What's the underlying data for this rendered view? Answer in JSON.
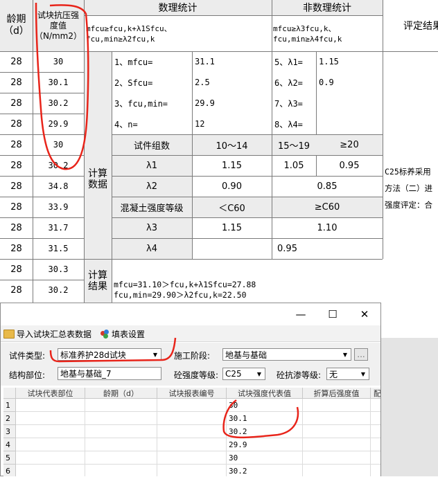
{
  "sheet": {
    "headers": {
      "age": "龄期\n（d）",
      "strength": "试块抗压强\n度值\n（N/mm2）",
      "stat": "数理统计",
      "nonstat": "非数理统计",
      "eval": "评定结果",
      "stat_formula_1": "mfcu≥fcu,k+λ1Sfcu、",
      "stat_formula_2": "fcu,min≥λ2fcu,k",
      "nonstat_formula_1": "mfcu≥λ3fcu,k、",
      "nonstat_formula_2": "fcu,min≥λ4fcu,k"
    },
    "rows": [
      {
        "age": "28",
        "value": "30"
      },
      {
        "age": "28",
        "value": "30.1"
      },
      {
        "age": "28",
        "value": "30.2"
      },
      {
        "age": "28",
        "value": "29.9"
      },
      {
        "age": "28",
        "value": "30"
      },
      {
        "age": "28",
        "value": "30.2"
      },
      {
        "age": "28",
        "value": "34.8"
      },
      {
        "age": "28",
        "value": "33.9"
      },
      {
        "age": "28",
        "value": "31.7"
      },
      {
        "age": "28",
        "value": "31.5"
      },
      {
        "age": "28",
        "value": "30.3"
      },
      {
        "age": "28",
        "value": "30.2"
      }
    ],
    "calc_data_label": "计算\n数据",
    "calc_result_label": "计算\n结果",
    "stats": [
      {
        "label": "1、mfcu=",
        "value": "31.1"
      },
      {
        "label": "2、Sfcu=",
        "value": "2.5"
      },
      {
        "label": "3、fcu,min=",
        "value": "29.9"
      },
      {
        "label": "4、n=",
        "value": "12"
      }
    ],
    "nonstats": [
      {
        "label": "5、λ1=",
        "value": "1.15"
      },
      {
        "label": "6、λ2=",
        "value": "0.9"
      },
      {
        "label": "7、λ3=",
        "value": ""
      },
      {
        "label": "8、λ4=",
        "value": ""
      }
    ],
    "coef": {
      "group_label": "试件组数",
      "g1": "10～14",
      "g2": "15～19",
      "g3": "≥20",
      "l1_label": "λ1",
      "l1_v1": "1.15",
      "l1_v2": "1.05",
      "l1_v3": "0.95",
      "l2_label": "λ2",
      "l2_v1": "0.90",
      "l2_v2": "0.85",
      "grade_label": "混凝土强度等级",
      "grade_lt": "＜C60",
      "grade_ge": "≥C60",
      "l3_label": "λ3",
      "l3_v1": "1.15",
      "l3_v2": "1.10",
      "l4_label": "λ4",
      "l4_v": "0.95"
    },
    "result_1": "mfcu=31.10＞fcu,k+λ1Sfcu=27.88",
    "result_2": "fcu,min=29.90＞λ2fcu,k=22.50",
    "eval_text_1": "C25标养采用",
    "eval_text_2": "方法（二）进",
    "eval_text_3": "强度评定：合"
  },
  "dialog": {
    "minimize_icon": "—",
    "maximize_icon": "☐",
    "close_icon": "✕",
    "toolbar": {
      "import_label": "导入试块汇总表数据",
      "settings_label": "填表设置"
    },
    "form": {
      "type_label": "试件类型:",
      "type_value": "标准养护28d试块",
      "stage_label": "施工阶段:",
      "stage_value": "地基与基础",
      "stage_more": "...",
      "part_label": "结构部位:",
      "part_value": "地基与基础_7",
      "grade_label": "砼强度等级:",
      "grade_value": "C25",
      "seep_label": "砼抗渗等级:",
      "seep_value": "无"
    },
    "grid": {
      "columns": [
        "试块代表部位",
        "龄期（d）",
        "试块报表编号",
        "试块强度代表值",
        "折算后强度值",
        "配"
      ],
      "rows": [
        {
          "n": "1",
          "value": "30"
        },
        {
          "n": "2",
          "value": "30.1"
        },
        {
          "n": "3",
          "value": "30.2"
        },
        {
          "n": "4",
          "value": "29.9"
        },
        {
          "n": "5",
          "value": "30"
        },
        {
          "n": "6",
          "value": "30.2"
        }
      ]
    }
  }
}
